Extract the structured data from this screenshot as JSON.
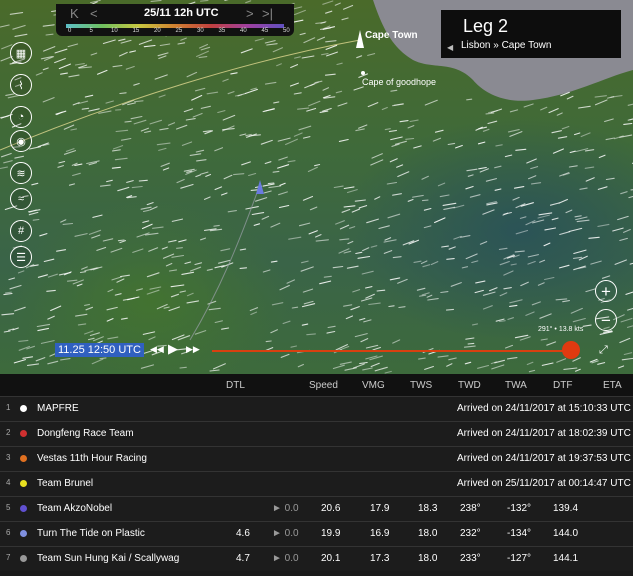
{
  "timebar": {
    "stamp": "25/11 12h UTC",
    "nav_first": "K",
    "nav_prev": "<",
    "nav_next": ">",
    "nav_last": ">|",
    "scale": [
      "0",
      "5",
      "10",
      "15",
      "20",
      "25",
      "30",
      "35",
      "40",
      "45",
      "50"
    ]
  },
  "leg": {
    "title": "Leg 2",
    "route": "Lisbon » Cape Town",
    "back_arrow": "◀"
  },
  "places": {
    "cape_town": "Cape Town",
    "cape_good_hope": "Cape of goodhope"
  },
  "tools": [
    "map-icon",
    "route-icon",
    "compass-icon",
    "boat-icon",
    "wind-icon",
    "waves-icon",
    "grid-icon",
    "layers-icon"
  ],
  "zoom": {
    "in": "+",
    "out": "−"
  },
  "bearing": "291° • 13.8 kts",
  "playback": {
    "time": "11.25 12:50 UTC",
    "rewind": "◀◀",
    "play": "▶",
    "forward": "▶▶",
    "fullscreen": "⤢"
  },
  "colors": {
    "accent": "#e03a10",
    "clock": "#3060c0"
  },
  "table": {
    "headers": [
      "DTL",
      "Speed",
      "VMG",
      "TWS",
      "TWD",
      "TWA",
      "DTF",
      "ETA"
    ],
    "rows": [
      {
        "rank": "1",
        "name": "MAPFRE",
        "color": "#ffffff",
        "status": "Arrived on 24/11/2017 at 15:10:33 UTC"
      },
      {
        "rank": "2",
        "name": "Dongfeng Race Team",
        "color": "#d03030",
        "status": "Arrived on 24/11/2017 at 18:02:39 UTC"
      },
      {
        "rank": "3",
        "name": "Vestas 11th Hour Racing",
        "color": "#e07020",
        "status": "Arrived on 24/11/2017 at 19:37:53 UTC"
      },
      {
        "rank": "4",
        "name": "Team Brunel",
        "color": "#e8e020",
        "status": "Arrived on 25/11/2017 at 00:14:47 UTC"
      },
      {
        "rank": "5",
        "name": "Team AkzoNobel",
        "color": "#6050d0",
        "dtl": "",
        "play": "► 0.0",
        "speed": "20.6",
        "vmg": "17.9",
        "tws": "18.3",
        "twd": "238°",
        "twa": "-132°",
        "dtf": "139.4"
      },
      {
        "rank": "6",
        "name": "Turn The Tide on Plastic",
        "color": "#8090e0",
        "dtl": "4.6",
        "play": "► 0.0",
        "speed": "19.9",
        "vmg": "16.9",
        "tws": "18.0",
        "twd": "232°",
        "twa": "-134°",
        "dtf": "144.0"
      },
      {
        "rank": "7",
        "name": "Team Sun Hung Kai / Scallywag",
        "color": "#999999",
        "dtl": "4.7",
        "play": "► 0.0",
        "speed": "20.1",
        "vmg": "17.3",
        "tws": "18.0",
        "twd": "233°",
        "twa": "-127°",
        "dtf": "144.1"
      }
    ]
  }
}
